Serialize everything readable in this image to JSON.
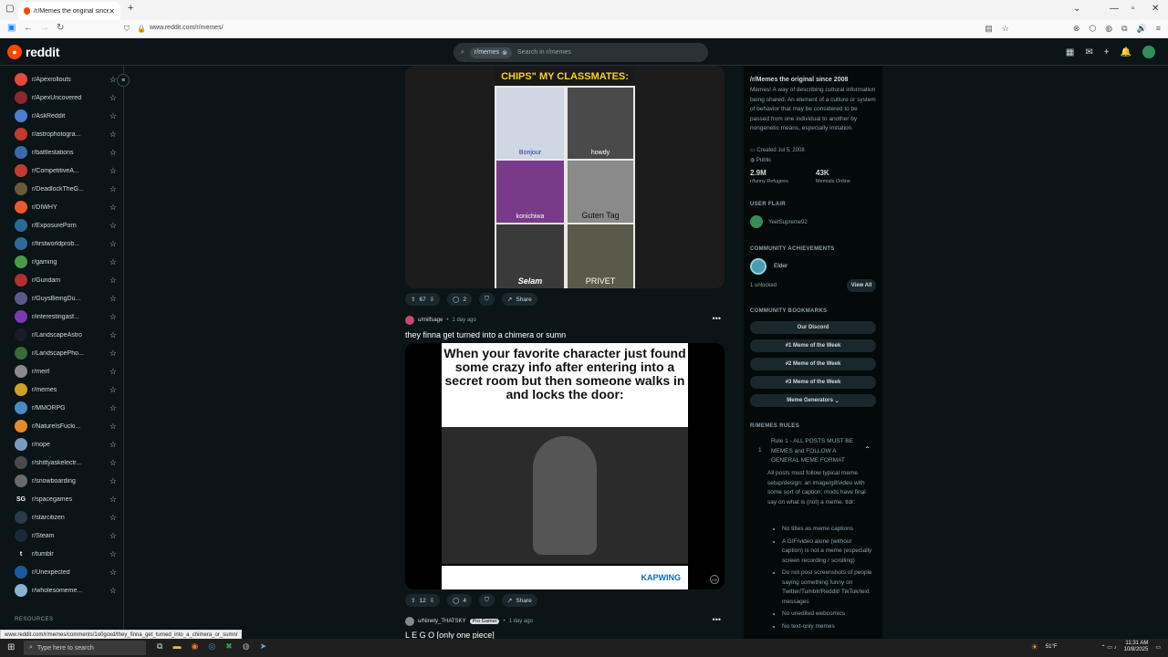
{
  "browser": {
    "tab_title": "/r/Memes the original since 20",
    "url": "www.reddit.com/r/memes/"
  },
  "header": {
    "logo": "reddit",
    "search_chip": "r/memes",
    "search_placeholder": "Search in r/memes"
  },
  "sidebar": {
    "items": [
      {
        "label": "r/Apexrollouts",
        "color": "#e04b3a"
      },
      {
        "label": "r/ApexUncovered",
        "color": "#8a2a2a"
      },
      {
        "label": "r/AskReddit",
        "color": "#4a7fd4"
      },
      {
        "label": "r/astrophotogra...",
        "color": "#c23a2a"
      },
      {
        "label": "r/battlestations",
        "color": "#3b6aa8"
      },
      {
        "label": "r/CompetitiveA...",
        "color": "#c43b2f"
      },
      {
        "label": "r/DeadlockTheG...",
        "color": "#6b5a3a"
      },
      {
        "label": "r/DIWHY",
        "color": "#e85a2a"
      },
      {
        "label": "r/ExposurePorn",
        "color": "#2a6a9a"
      },
      {
        "label": "r/firstworldprob...",
        "color": "#2d6a9c"
      },
      {
        "label": "r/gaming",
        "color": "#4a9a4a"
      },
      {
        "label": "r/Gundam",
        "color": "#b03030"
      },
      {
        "label": "r/GuysBeingDu...",
        "color": "#5a5a8a"
      },
      {
        "label": "r/interestingasf...",
        "color": "#7a3ab0"
      },
      {
        "label": "r/LandscapeAstro",
        "color": "#1a1a2a"
      },
      {
        "label": "r/LandscapePho...",
        "color": "#3a6a3a"
      },
      {
        "label": "r/meirl",
        "color": "#8a8a8a"
      },
      {
        "label": "r/memes",
        "color": "#d4a020"
      },
      {
        "label": "r/MMORPG",
        "color": "#4a8ac4"
      },
      {
        "label": "r/NatureIsFucki...",
        "color": "#e8892a"
      },
      {
        "label": "r/nope",
        "color": "#7a9ac4"
      },
      {
        "label": "r/shittyaskelectr...",
        "color": "#4a4a4a"
      },
      {
        "label": "r/snowboarding",
        "color": "#6a6a6a"
      },
      {
        "label": "r/spacegames",
        "color": "#0b1416",
        "glyph": "SG"
      },
      {
        "label": "r/starcitizen",
        "color": "#2a3a4a"
      },
      {
        "label": "r/Steam",
        "color": "#1b2838"
      },
      {
        "label": "r/tumblr",
        "color": "#0b1416",
        "glyph": "t"
      },
      {
        "label": "r/Unexpected",
        "color": "#1a5a9a"
      },
      {
        "label": "r/wholesomeme...",
        "color": "#8ab0d4"
      }
    ],
    "resources_label": "RESOURCES"
  },
  "post1": {
    "banner": "CHIPS\" MY CLASSMATES:",
    "cells": [
      "Bonjour",
      "howdy",
      "konichiwa",
      "Guten Tag",
      "Selam",
      "PRIVET"
    ],
    "votes": "67",
    "comments": "2",
    "share": "Share"
  },
  "post2": {
    "user": "u/milfsage",
    "time": "1 day ago",
    "title": "they finna get turned into a chimera or sumn",
    "caption": "When your favorite character just found some crazy info after entering into a secret room but then someone walks in and locks the door:",
    "watermark": "KAPWING",
    "gif_badge": "GIF",
    "votes": "12",
    "comments": "4",
    "share": "Share"
  },
  "post3": {
    "user": "u/Ninety_THATSKY",
    "flair": "Pro Gamer",
    "time": "1 day ago",
    "title": "L E G O [only one piece]"
  },
  "rightbar": {
    "title": "/r/Memes the original since 2008",
    "description": "Memes! A way of describing cultural information being shared. An element of a culture or system of behavior that may be considered to be passed from one individual to another by nongenetic means, especially imitation.",
    "created": "Created Jul 5, 2008",
    "visibility": "Public",
    "members": "2.9M",
    "members_label": "r/funny Refugees",
    "online": "43K",
    "online_label": "Memists Online",
    "user_flair_head": "USER FLAIR",
    "user_flair_name": "YeetSupreme92",
    "achievements_head": "COMMUNITY ACHIEVEMENTS",
    "achievement_name": "Elder",
    "unlocked": "1 unlocked",
    "view_all": "View All",
    "bookmarks_head": "COMMUNITY BOOKMARKS",
    "bookmarks": [
      "Our Discord",
      "#1 Meme of the Week",
      "#2 Meme of the Week",
      "#3 Meme of the Week",
      "Meme Generators"
    ],
    "rules_head": "R/MEMES RULES",
    "rule_num": "1",
    "rule_title": "Rule 1 - ALL POSTS MUST BE MEMES and FOLLOW A GENERAL MEME FORMAT",
    "rule_body": "All posts must follow typical meme setup/design: an image/gif/video with some sort of caption; mods have final say on what is (not) a meme. tldr:",
    "rule_bullets": [
      "No titles as meme captions",
      "A GIF/video alone (without caption) is not a meme (especially screen recording / scrolling)",
      "Do not post screenshots of people saying something funny on Twitter/Tumblr/Reddit/ TikTok/text messages",
      "No unedited webcomics",
      "No text-only memes"
    ]
  },
  "status_url": "www.reddit.com/r/memes/comments/1o0goxd/they_finna_get_turned_into_a_chimera_or_sumn/",
  "taskbar": {
    "search_placeholder": "Type here to search",
    "weather": "51°F",
    "time": "11:31 AM",
    "date": "10/8/2025"
  }
}
